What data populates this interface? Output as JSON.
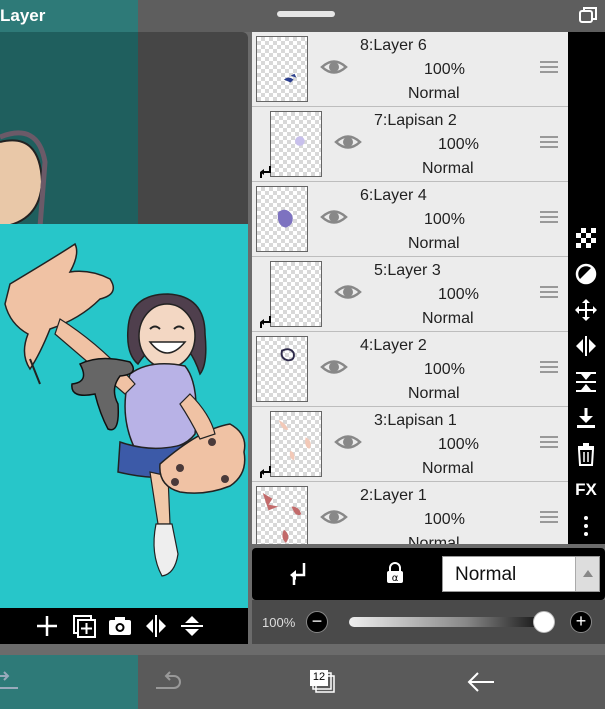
{
  "window": {
    "title": "Layer",
    "icons": {
      "restore": "restore-icon"
    }
  },
  "canvas_toolbar": {
    "icons": [
      "plus-icon",
      "duplicate-layer-icon",
      "camera-icon",
      "flip-horizontal-icon",
      "flip-vertical-icon"
    ]
  },
  "layers": [
    {
      "name": "8:Layer 6",
      "opacity": "100%",
      "blend": "Normal",
      "clipped": false
    },
    {
      "name": "7:Lapisan 2",
      "opacity": "100%",
      "blend": "Normal",
      "clipped": true
    },
    {
      "name": "6:Layer 4",
      "opacity": "100%",
      "blend": "Normal",
      "clipped": false
    },
    {
      "name": "5:Layer 3",
      "opacity": "100%",
      "blend": "Normal",
      "clipped": true
    },
    {
      "name": "4:Layer 2",
      "opacity": "100%",
      "blend": "Normal",
      "clipped": false
    },
    {
      "name": "3:Lapisan 1",
      "opacity": "100%",
      "blend": "Normal",
      "clipped": true
    },
    {
      "name": "2:Layer 1",
      "opacity": "100%",
      "blend": "Normal",
      "clipped": false
    }
  ],
  "tool_column": {
    "icons": [
      "checker-transparency-icon",
      "mask-circle-icon",
      "move-icon",
      "flip-horizontal-icon",
      "merge-down-icon",
      "download-icon",
      "trash-icon",
      "fx-icon",
      "more-vertical-icon"
    ],
    "fx_label": "FX"
  },
  "layer_controls": {
    "blend_mode": "Normal",
    "icons": [
      "clipping-icon",
      "alpha-lock-icon",
      "dropdown-arrow-icon"
    ]
  },
  "opacity_control": {
    "value_label": "100%",
    "value": 1.0,
    "minus": "−",
    "plus": "+"
  },
  "bottom_nav": {
    "layer_count": "12",
    "icons": [
      "undo-icon",
      "redo-icon",
      "layers-count-icon",
      "back-arrow-icon"
    ]
  },
  "colors": {
    "canvas_bg": "#27c6c9",
    "panel_bg": "#ececec",
    "toolbar_bg": "#000000",
    "teal_strip": "#2e7a78"
  }
}
